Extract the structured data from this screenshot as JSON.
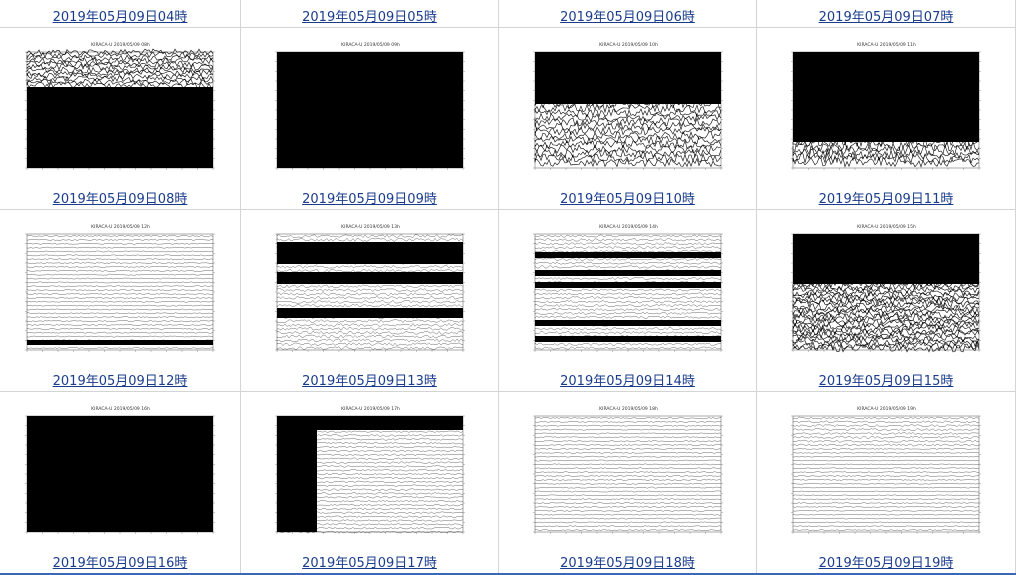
{
  "top_row": [
    {
      "label": "2019年05月09日04時"
    },
    {
      "label": "2019年05月09日05時"
    },
    {
      "label": "2019年05月09日06時"
    },
    {
      "label": "2019年05月09日07時"
    }
  ],
  "cells": [
    {
      "label": "2019年05月09日08時",
      "chart_title": "KIRACA-U  2019/05/09  08h",
      "pattern": "dense_top"
    },
    {
      "label": "2019年05月09日09時",
      "chart_title": "KIRACA-U  2019/05/09  09h",
      "pattern": "black"
    },
    {
      "label": "2019年05月09日10時",
      "chart_title": "KIRACA-U  2019/05/09  10h",
      "pattern": "dense_mid"
    },
    {
      "label": "2019年05月09日11時",
      "chart_title": "KIRACA-U  2019/05/09  11h",
      "pattern": "black_bottom"
    },
    {
      "label": "2019年05月09日12時",
      "chart_title": "KIRACA-U  2019/05/09  12h",
      "pattern": "quiet_band"
    },
    {
      "label": "2019年05月09日13時",
      "chart_title": "KIRACA-U  2019/05/09  13h",
      "pattern": "bands"
    },
    {
      "label": "2019年05月09日14時",
      "chart_title": "KIRACA-U  2019/05/09  14h",
      "pattern": "stripes"
    },
    {
      "label": "2019年05月09日15時",
      "chart_title": "KIRACA-U  2019/05/09  15h",
      "pattern": "noisy"
    },
    {
      "label": "2019年05月09日16時",
      "chart_title": "KIRACA-U  2019/05/09  16h",
      "pattern": "black2"
    },
    {
      "label": "2019年05月09日17時",
      "chart_title": "KIRACA-U  2019/05/09  17h",
      "pattern": "drip"
    },
    {
      "label": "2019年05月09日18時",
      "chart_title": "KIRACA-U  2019/05/09  18h",
      "pattern": "quiet"
    },
    {
      "label": "2019年05月09日19時",
      "chart_title": "KIRACA-U  2019/05/09  19h",
      "pattern": "quiet_top"
    }
  ],
  "colors": {
    "link": "#1a3c8c",
    "border": "#d4d4d4",
    "trace": "#000000",
    "bottom_line": "#3a67b8"
  }
}
